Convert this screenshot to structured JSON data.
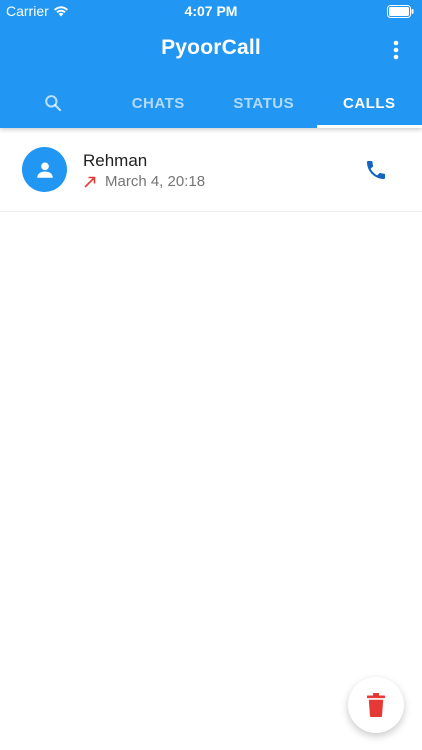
{
  "status_bar": {
    "carrier": "Carrier",
    "time": "4:07 PM"
  },
  "app_bar": {
    "title": "PyoorCall"
  },
  "tabs": [
    {
      "label": "",
      "icon": "search-icon"
    },
    {
      "label": "CHATS"
    },
    {
      "label": "STATUS"
    },
    {
      "label": "CALLS",
      "active": true
    }
  ],
  "calls": [
    {
      "name": "Rehman",
      "time": "March 4, 20:18",
      "direction_icon": "outgoing-call-arrow-icon",
      "action_icon": "phone-icon"
    }
  ],
  "fab": {
    "icon": "trash-icon"
  },
  "colors": {
    "primary": "#2196F3",
    "outgoing_arrow": "#E53935",
    "phone_icon": "#1565C0",
    "delete": "#E53935"
  }
}
